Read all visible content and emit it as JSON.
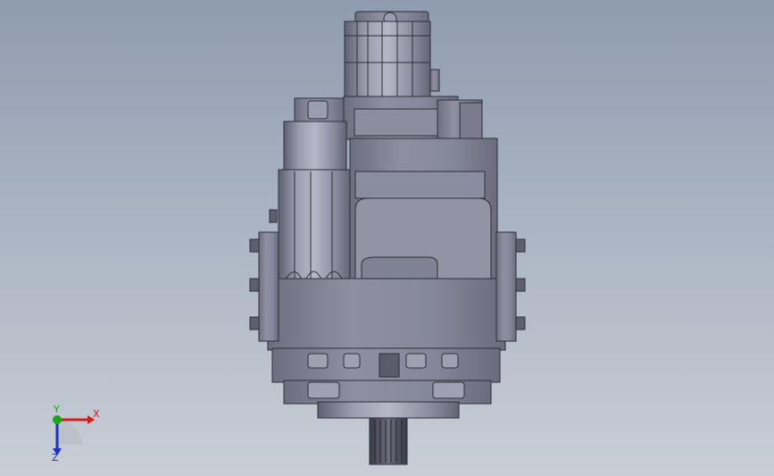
{
  "viewport": {
    "background_top": "#8f9cb0",
    "background_bottom": "#c9ced6"
  },
  "model": {
    "body_color": "#7f8194",
    "body_light": "#a4a6b8",
    "body_dark": "#5f6173",
    "edge_color": "#2d2e38"
  },
  "triad": {
    "x_label": "X",
    "y_label": "Y",
    "z_label": "Z",
    "x_color": "#d11f1f",
    "y_color": "#1aa51a",
    "z_color": "#1c2fd6"
  }
}
